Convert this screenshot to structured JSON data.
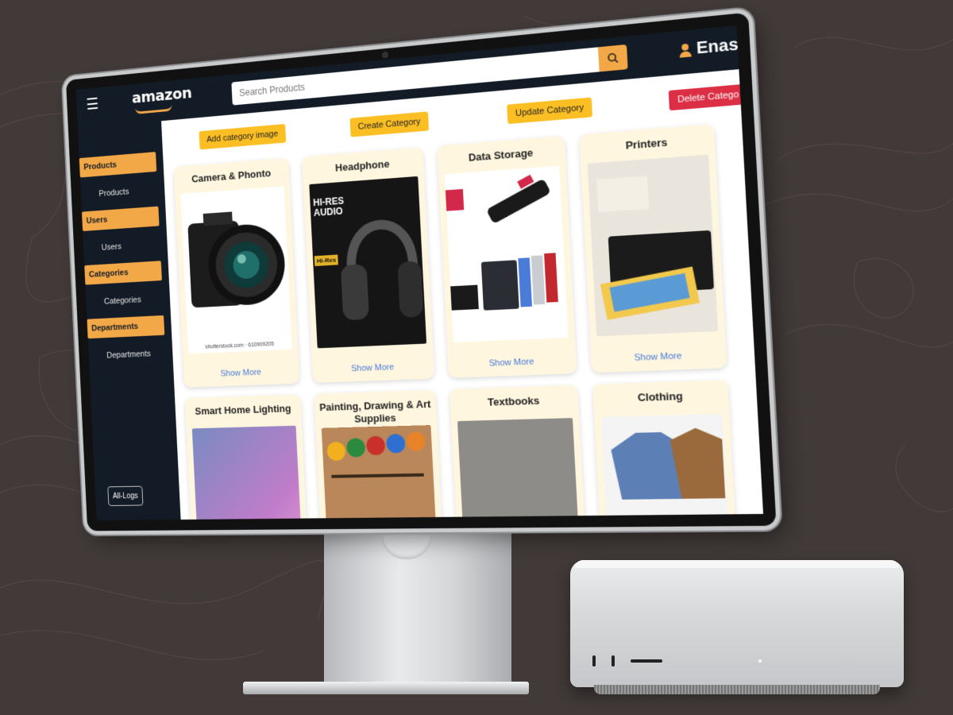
{
  "topbar": {
    "logo": "amazon",
    "search_placeholder": "Search Products",
    "user_name": "Enas Awad"
  },
  "sidebar": {
    "sections": [
      {
        "heading": "Products",
        "link": "Products"
      },
      {
        "heading": "Users",
        "link": "Users"
      },
      {
        "heading": "Categories",
        "link": "Categories"
      },
      {
        "heading": "Departments",
        "link": "Departments"
      }
    ],
    "logs_button": "All-Logs"
  },
  "actions": {
    "add_image": "Add category image",
    "create": "Create Category",
    "update": "Update Category",
    "delete": "Delete Catego"
  },
  "cards": [
    {
      "title": "Camera & Phonto",
      "more": "Show More",
      "caption": "shutterstock.com · 610909205"
    },
    {
      "title": "Headphone",
      "more": "Show More",
      "caption": ""
    },
    {
      "title": "Data Storage",
      "more": "Show More",
      "caption": ""
    },
    {
      "title": "Printers",
      "more": "Show More",
      "caption": ""
    },
    {
      "title": "Smart Home Lighting",
      "more": "",
      "caption": ""
    },
    {
      "title": "Painting, Drawing & Art Supplies",
      "more": "",
      "caption": ""
    },
    {
      "title": "Textbooks",
      "more": "",
      "caption": ""
    },
    {
      "title": "Clothing",
      "more": "",
      "caption": ""
    }
  ],
  "headphone_ad": {
    "line1": "HI-RES",
    "line2": "AUDIO",
    "badge": "Hi-Res"
  },
  "colors": {
    "accent": "#f3a847",
    "topbar": "#131b26",
    "card": "#fef6df",
    "delete": "#dc2f45",
    "link": "#4a7bdc"
  }
}
